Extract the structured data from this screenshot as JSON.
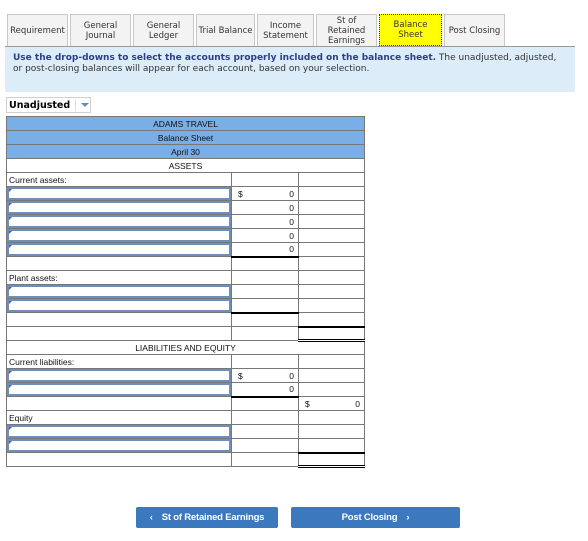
{
  "tabs": [
    {
      "label": "Requirement",
      "active": false
    },
    {
      "label": "General Journal",
      "active": false
    },
    {
      "label": "General Ledger",
      "active": false
    },
    {
      "label": "Trial Balance",
      "active": false
    },
    {
      "label": "Income Statement",
      "active": false
    },
    {
      "label": "St of Retained Earnings",
      "active": false
    },
    {
      "label": "Balance Sheet",
      "active": true
    },
    {
      "label": "Post Closing",
      "active": false
    }
  ],
  "instructions": {
    "bold": "Use the drop-downs to select the accounts properly included on the balance sheet.",
    "normal": " The unadjusted, adjusted, or post-closing balances will appear for each account, based on your selection."
  },
  "balance_dropdown": {
    "selected": "Unadjusted"
  },
  "sheet": {
    "company": "ADAMS TRAVEL",
    "title": "Balance Sheet",
    "date": "April 30",
    "assets_heading": "ASSETS",
    "current_assets_label": "Current assets:",
    "current_assets": [
      {
        "account": "",
        "currency": "$",
        "amount": "0"
      },
      {
        "account": "",
        "currency": "",
        "amount": "0"
      },
      {
        "account": "",
        "currency": "",
        "amount": "0"
      },
      {
        "account": "",
        "currency": "",
        "amount": "0"
      },
      {
        "account": "",
        "currency": "",
        "amount": "0"
      }
    ],
    "plant_assets_label": "Plant assets:",
    "liab_equity_heading": "LIABILITIES AND EQUITY",
    "current_liabilities_label": "Current liabilities:",
    "current_liabilities": [
      {
        "account": "",
        "currency": "$",
        "amount": "0"
      },
      {
        "account": "",
        "currency": "",
        "amount": "0"
      }
    ],
    "total_liabilities": {
      "currency": "$",
      "amount": "0"
    },
    "equity_label": "Equity"
  },
  "nav": {
    "prev_label": "St of Retained Earnings",
    "next_label": "Post Closing",
    "prev_icon": "chevron-left-icon",
    "next_icon": "chevron-right-icon"
  }
}
